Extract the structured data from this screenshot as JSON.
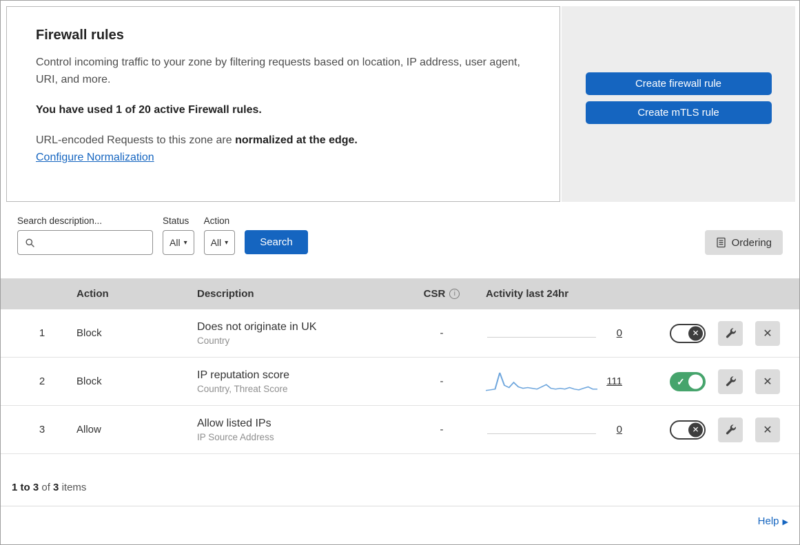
{
  "intro": {
    "title": "Firewall rules",
    "description": "Control incoming traffic to your zone by filtering requests based on location, IP address, user agent, URI, and more.",
    "usage_note": "You have used 1 of 20 active Firewall rules.",
    "normalization_prefix": "URL-encoded Requests to this zone are",
    "normalization_bold": "normalized at the edge.",
    "configure_link": "Configure Normalization"
  },
  "actions": {
    "create_firewall_rule": "Create firewall rule",
    "create_mtls_rule": "Create mTLS rule"
  },
  "filters": {
    "search_label": "Search description...",
    "status_label": "Status",
    "status_value": "All",
    "action_label": "Action",
    "action_value": "All",
    "search_button": "Search",
    "ordering_button": "Ordering"
  },
  "table": {
    "headers": {
      "action": "Action",
      "description": "Description",
      "csr": "CSR",
      "activity": "Activity last 24hr"
    },
    "rows": [
      {
        "priority": "1",
        "action": "Block",
        "description": "Does not originate in UK",
        "criteria": "Country",
        "csr": "-",
        "activity_count": "0",
        "enabled": false,
        "sparkline": []
      },
      {
        "priority": "2",
        "action": "Block",
        "description": "IP reputation score",
        "criteria": "Country, Threat Score",
        "csr": "-",
        "activity_count": "111",
        "enabled": true,
        "sparkline": [
          2,
          3,
          4,
          26,
          9,
          6,
          13,
          7,
          5,
          6,
          5,
          4,
          7,
          10,
          5,
          4,
          5,
          4,
          6,
          4,
          3,
          5,
          7,
          4,
          4
        ]
      },
      {
        "priority": "3",
        "action": "Allow",
        "description": "Allow listed IPs",
        "criteria": "IP Source Address",
        "csr": "-",
        "activity_count": "0",
        "enabled": false,
        "sparkline": []
      }
    ]
  },
  "footer": {
    "range": "1 to 3",
    "of": "of",
    "total": "3",
    "items": "items",
    "help": "Help"
  },
  "icons": {
    "info": "i",
    "close_x": "✕",
    "toggle_x": "✕",
    "check": "✓",
    "caret_down": "▾",
    "help_arrow": "▶"
  },
  "colors": {
    "accent_blue": "#1565c0",
    "toggle_green": "#46a46c",
    "table_header_gray": "#d6d6d6",
    "sparkline_blue": "#6ea6dd"
  }
}
